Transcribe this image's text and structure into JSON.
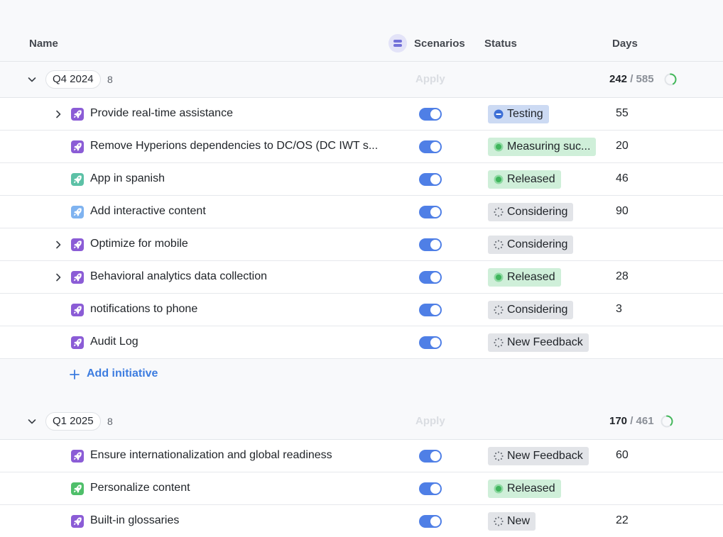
{
  "header": {
    "name_label": "Name",
    "scenarios_label": "Scenarios",
    "status_label": "Status",
    "days_label": "Days"
  },
  "groups": [
    {
      "label": "Q4 2024",
      "count": "8",
      "apply_label": "Apply",
      "days_used": "242",
      "days_sep": " / ",
      "days_total": "585",
      "progress_fraction": 0.41,
      "rows": [
        {
          "name": "Provide real-time assistance",
          "expandable": true,
          "icon_color": "#8b5cd6",
          "status": "Testing",
          "status_kind": "testing",
          "days": "55"
        },
        {
          "name": "Remove Hyperions dependencies to DC/OS (DC IWT s...",
          "expandable": false,
          "icon_color": "#8b5cd6",
          "status": "Measuring suc...",
          "status_kind": "released",
          "days": "20"
        },
        {
          "name": "App in spanish",
          "expandable": false,
          "icon_color": "#5cc1a6",
          "status": "Released",
          "status_kind": "released",
          "days": "46"
        },
        {
          "name": "Add interactive content",
          "expandable": false,
          "icon_color": "#7fb3f0",
          "status": "Considering",
          "status_kind": "gray",
          "days": "90"
        },
        {
          "name": "Optimize for mobile",
          "expandable": true,
          "icon_color": "#8b5cd6",
          "status": "Considering",
          "status_kind": "gray",
          "days": ""
        },
        {
          "name": "Behavioral analytics data collection",
          "expandable": true,
          "icon_color": "#8b5cd6",
          "status": "Released",
          "status_kind": "released",
          "days": "28"
        },
        {
          "name": "notifications to phone",
          "expandable": false,
          "icon_color": "#8b5cd6",
          "status": "Considering",
          "status_kind": "gray",
          "days": "3"
        },
        {
          "name": "Audit Log",
          "expandable": false,
          "icon_color": "#8b5cd6",
          "status": "New Feedback",
          "status_kind": "gray",
          "days": ""
        }
      ]
    },
    {
      "label": "Q1 2025",
      "count": "8",
      "apply_label": "Apply",
      "days_used": "170",
      "days_sep": " / ",
      "days_total": "461",
      "progress_fraction": 0.37,
      "rows": [
        {
          "name": "Ensure internationalization and global readiness",
          "expandable": false,
          "icon_color": "#8b5cd6",
          "status": "New Feedback",
          "status_kind": "gray",
          "days": "60"
        },
        {
          "name": "Personalize content",
          "expandable": false,
          "icon_color": "#4fbf6a",
          "status": "Released",
          "status_kind": "released",
          "days": ""
        },
        {
          "name": "Built-in glossaries",
          "expandable": false,
          "icon_color": "#8b5cd6",
          "status": "New",
          "status_kind": "gray",
          "days": "22"
        }
      ]
    }
  ],
  "add_initiative_label": "Add initiative",
  "colors": {
    "accent": "#3d7de0",
    "toggle_on": "#4f7fe6",
    "released_dot": "#3fb55c",
    "testing_dot": "#3d6fd6",
    "progress_ring": "#43b85a"
  }
}
